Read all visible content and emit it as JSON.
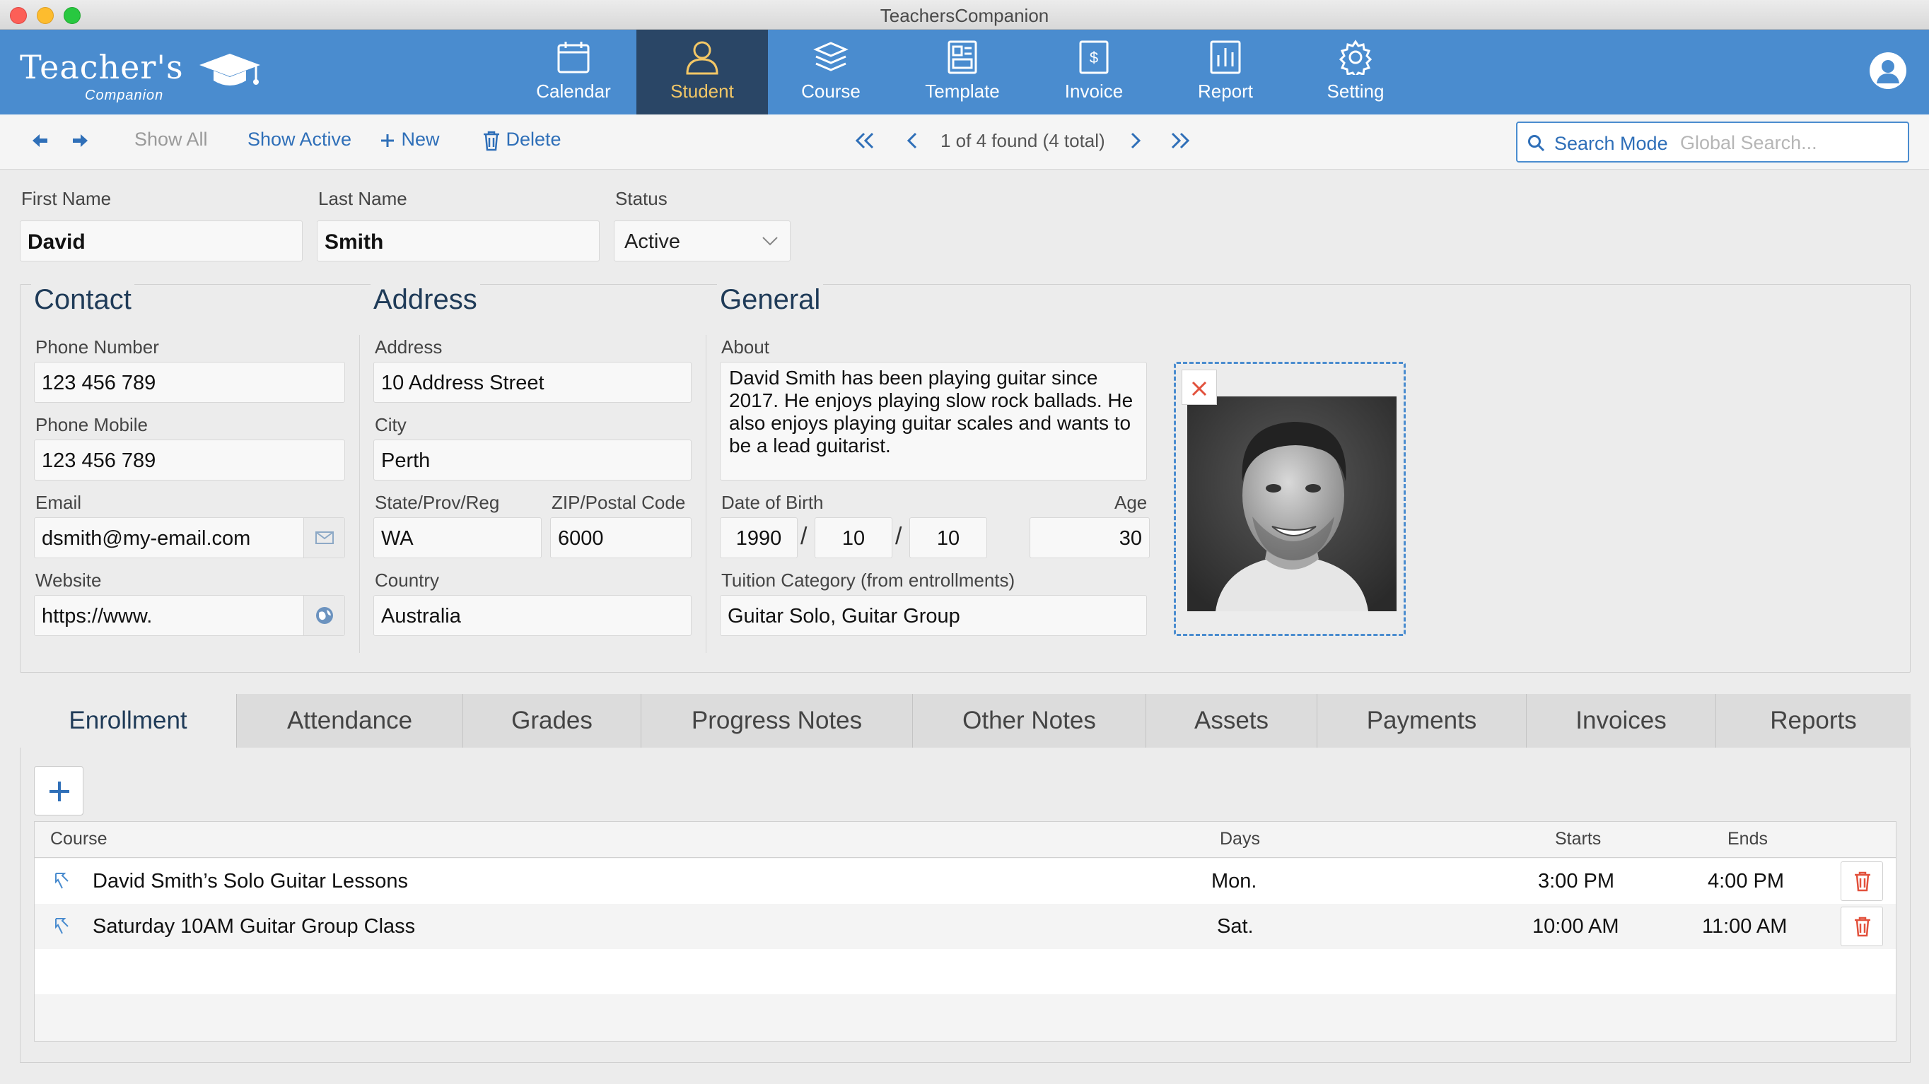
{
  "window": {
    "title": "TeachersCompanion"
  },
  "logo": {
    "main": "Teacher's",
    "sub": "Companion"
  },
  "nav": [
    {
      "label": "Calendar",
      "icon": "calendar-icon"
    },
    {
      "label": "Student",
      "icon": "student-icon",
      "active": true
    },
    {
      "label": "Course",
      "icon": "course-icon"
    },
    {
      "label": "Template",
      "icon": "template-icon"
    },
    {
      "label": "Invoice",
      "icon": "invoice-icon"
    },
    {
      "label": "Report",
      "icon": "report-icon"
    },
    {
      "label": "Setting",
      "icon": "gear-icon"
    }
  ],
  "toolbar": {
    "show_all": "Show All",
    "show_active": "Show Active",
    "new": "New",
    "delete": "Delete",
    "record_count": "1 of 4 found (4 total)",
    "search_mode": "Search Mode",
    "search_placeholder": "Global Search..."
  },
  "student": {
    "first_name_label": "First Name",
    "first_name": "David",
    "last_name_label": "Last Name",
    "last_name": "Smith",
    "status_label": "Status",
    "status": "Active"
  },
  "contact": {
    "title": "Contact",
    "phone_label": "Phone Number",
    "phone": "123 456 789",
    "mobile_label": "Phone Mobile",
    "mobile": "123 456 789",
    "email_label": "Email",
    "email": "dsmith@my-email.com",
    "website_label": "Website",
    "website": "https://www."
  },
  "address": {
    "title": "Address",
    "address_label": "Address",
    "address": "10 Address Street",
    "city_label": "City",
    "city": "Perth",
    "state_label": "State/Prov/Reg",
    "state": "WA",
    "zip_label": "ZIP/Postal Code",
    "zip": "6000",
    "country_label": "Country",
    "country": "Australia"
  },
  "general": {
    "title": "General",
    "about_label": "About",
    "about": "David Smith has been playing guitar since 2017. He enjoys playing slow rock ballads. He also enjoys playing guitar scales and wants to be a lead guitarist.",
    "dob_label": "Date of Birth",
    "dob_year": "1990",
    "dob_month": "10",
    "dob_day": "10",
    "dob_sep": "/",
    "age_label": "Age",
    "age": "30",
    "tuition_label": "Tuition Category (from entrollments)",
    "tuition": "Guitar Solo, Guitar Group"
  },
  "tabs": [
    {
      "label": "Enrollment",
      "active": true
    },
    {
      "label": "Attendance"
    },
    {
      "label": "Grades"
    },
    {
      "label": "Progress Notes"
    },
    {
      "label": "Other Notes"
    },
    {
      "label": "Assets"
    },
    {
      "label": "Payments"
    },
    {
      "label": "Invoices"
    },
    {
      "label": "Reports"
    }
  ],
  "enrollment": {
    "columns": {
      "course": "Course",
      "days": "Days",
      "starts": "Starts",
      "ends": "Ends"
    },
    "rows": [
      {
        "course": "David Smith’s Solo Guitar Lessons",
        "days": "Mon.",
        "starts": "3:00 PM",
        "ends": "4:00 PM"
      },
      {
        "course": "Saturday 10AM Guitar Group Class",
        "days": "Sat.",
        "starts": "10:00 AM",
        "ends": "11:00 AM"
      }
    ]
  },
  "colors": {
    "header": "#4a8ccf",
    "active_nav": "#2a4666",
    "accent": "#2f6fb8",
    "active_label": "#f3c766",
    "delete": "#e2513c"
  }
}
